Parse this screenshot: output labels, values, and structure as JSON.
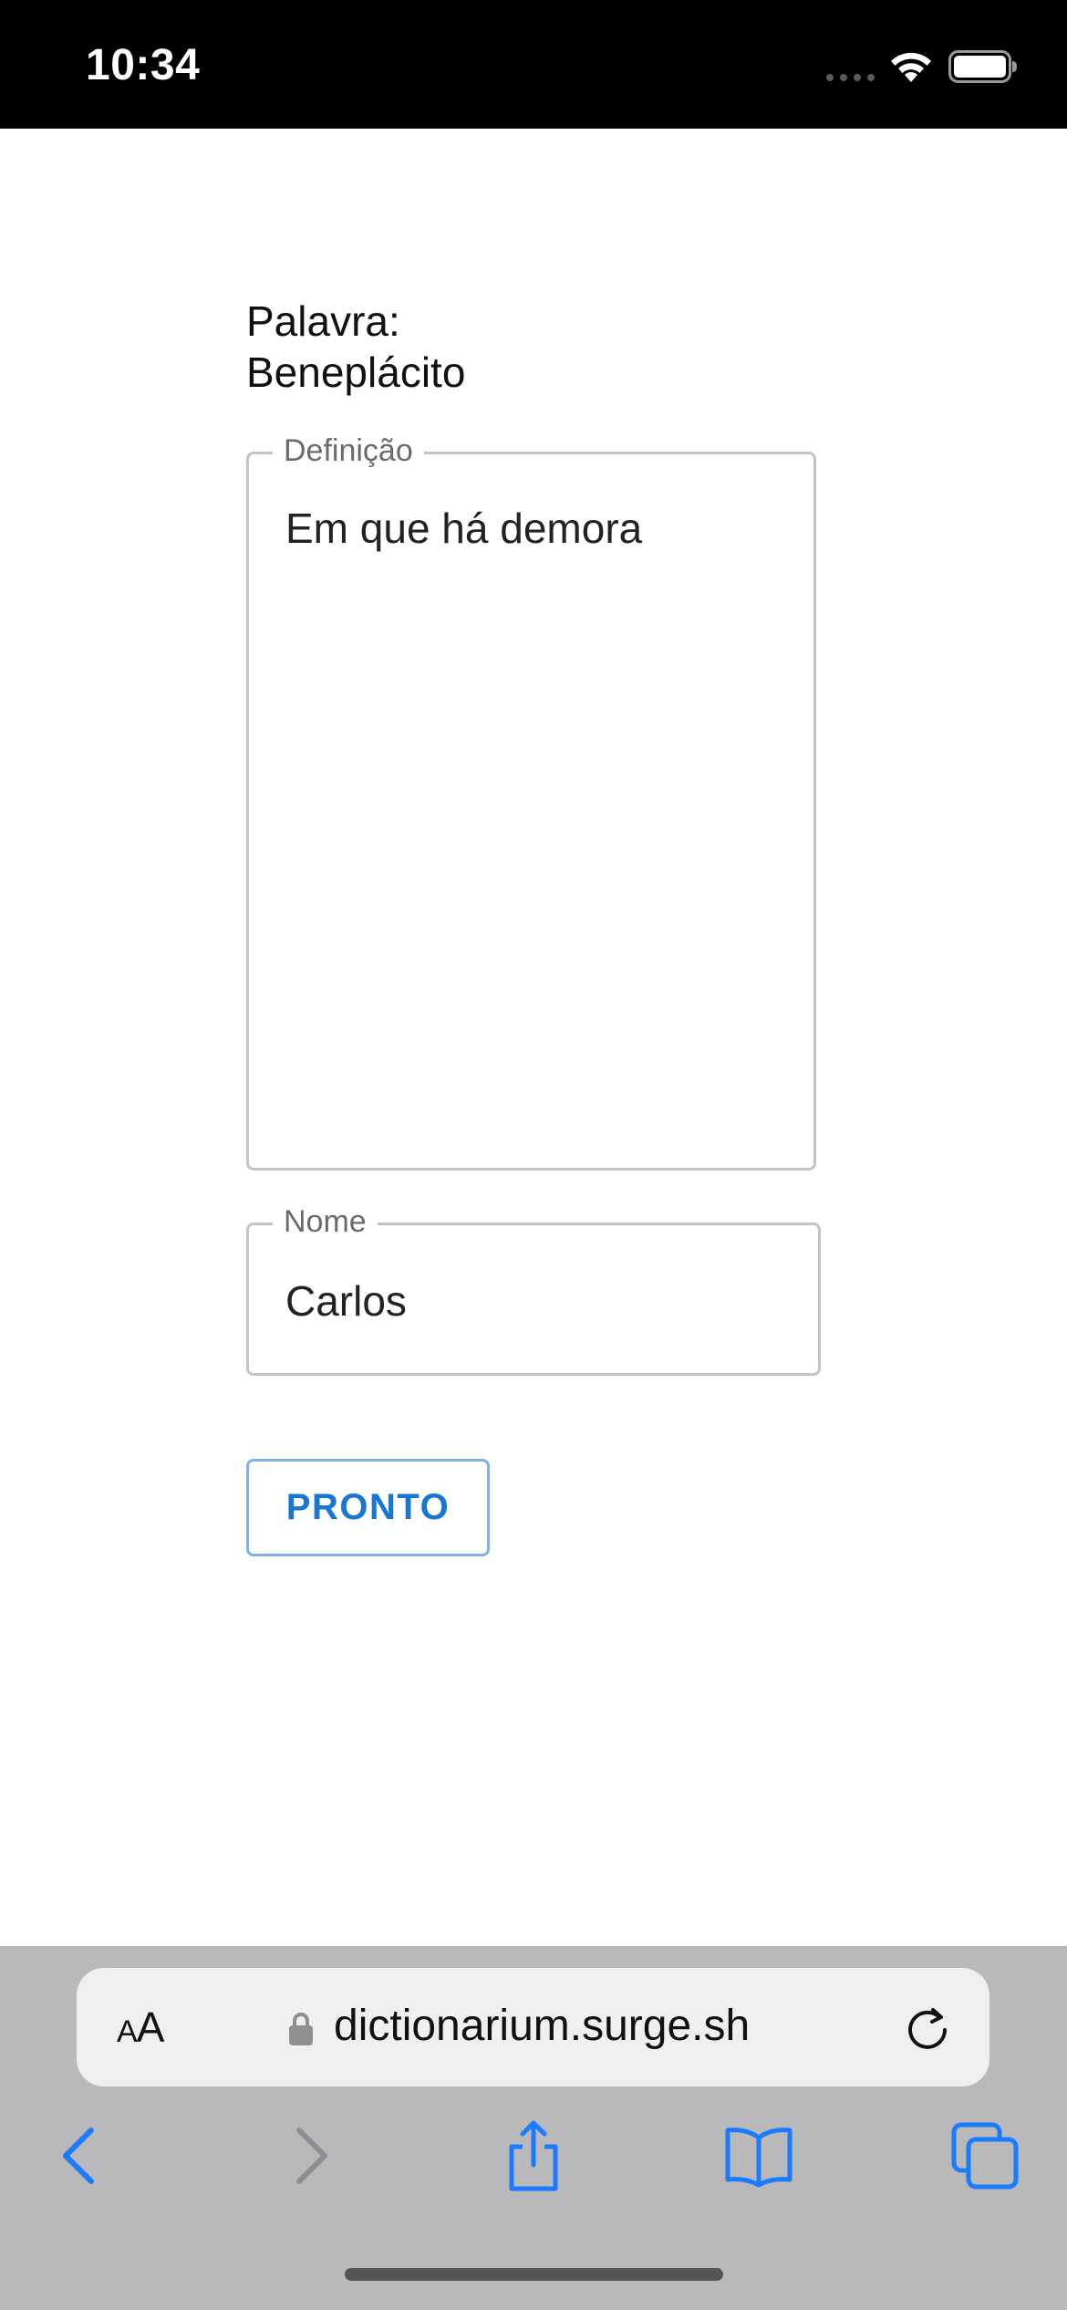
{
  "status_bar": {
    "time": "10:34"
  },
  "form": {
    "word_label": "Palavra:",
    "word_value": "Beneplácito",
    "definition": {
      "label": "Definição",
      "value": "Em que há demora"
    },
    "name": {
      "label": "Nome",
      "value": "Carlos"
    },
    "submit_label": "PRONTO"
  },
  "browser": {
    "text_size_label_small": "A",
    "text_size_label_large": "A",
    "url": "dictionarium.surge.sh"
  },
  "colors": {
    "accent": "#1976d2",
    "button_border": "#7eb1e8",
    "toolbar_icon": "#1a7bff",
    "toolbar_icon_disabled": "#8e8e93"
  },
  "icons": {
    "status": [
      "cellular-signal-icon",
      "wifi-icon",
      "battery-icon"
    ],
    "url_bar": [
      "text-size-icon",
      "lock-icon",
      "reload-icon"
    ],
    "toolbar": [
      "back-icon",
      "forward-icon",
      "share-icon",
      "bookmarks-icon",
      "tabs-icon"
    ]
  }
}
